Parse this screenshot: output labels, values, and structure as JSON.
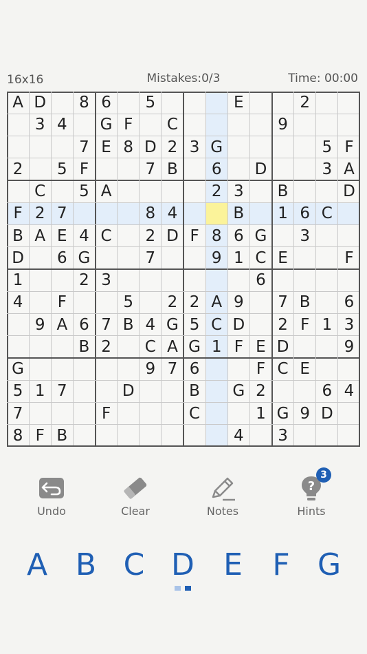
{
  "header": {
    "grid_size": "16x16",
    "mistakes": "Mistakes:0/3",
    "time": "Time: 00:00"
  },
  "board": {
    "size": 16,
    "selected": [
      5,
      9
    ],
    "colors": {
      "highlight": "#e3eefa",
      "selected": "#fbf39a",
      "digit": "#222222"
    },
    "rows": [
      [
        "A",
        "D",
        "",
        "8",
        "6",
        "",
        "5",
        "",
        "",
        "",
        "E",
        "",
        "",
        "2",
        "",
        ""
      ],
      [
        "",
        "3",
        "4",
        "",
        "G",
        "F",
        "",
        "C",
        "",
        "",
        "",
        "",
        "9",
        "",
        "",
        ""
      ],
      [
        "",
        "",
        "",
        "7",
        "E",
        "8",
        "D",
        "2",
        "3",
        "G",
        "",
        "",
        "",
        "",
        "5",
        "F"
      ],
      [
        "2",
        "",
        "5",
        "F",
        "",
        "",
        "7",
        "B",
        "",
        "6",
        "",
        "D",
        "",
        "",
        "3",
        "A"
      ],
      [
        "",
        "C",
        "",
        "5",
        "A",
        "",
        "",
        "",
        "",
        "2",
        "3",
        "",
        "B",
        "",
        "",
        "D"
      ],
      [
        "F",
        "2",
        "7",
        "",
        "",
        "",
        "8",
        "4",
        "",
        "",
        "B",
        "",
        "1",
        "6",
        "C",
        ""
      ],
      [
        "B",
        "A",
        "E",
        "4",
        "C",
        "",
        "2",
        "D",
        "F",
        "8",
        "6",
        "G",
        "",
        "3",
        "",
        ""
      ],
      [
        "D",
        "",
        "6",
        "G",
        "",
        "",
        "7",
        "",
        "",
        "9",
        "1",
        "C",
        "E",
        "",
        "",
        "F"
      ],
      [
        "1",
        "",
        "",
        "2",
        "3",
        "",
        "",
        "",
        "",
        "",
        "",
        "6",
        "",
        "",
        "",
        ""
      ],
      [
        "4",
        "",
        "F",
        "",
        "",
        "5",
        "",
        "2",
        "2",
        "A",
        "9",
        "",
        "7",
        "B",
        "",
        "6"
      ],
      [
        "",
        "9",
        "A",
        "6",
        "7",
        "B",
        "4",
        "G",
        "5",
        "C",
        "D",
        "",
        "2",
        "F",
        "1",
        "3"
      ],
      [
        "",
        "",
        "",
        "B",
        "2",
        "",
        "C",
        "A",
        "G",
        "1",
        "F",
        "E",
        "D",
        "",
        "",
        "9"
      ],
      [
        "G",
        "",
        "",
        "",
        "",
        "",
        "9",
        "7",
        "6",
        "",
        "",
        "F",
        "C",
        "E",
        "",
        ""
      ],
      [
        "5",
        "1",
        "7",
        "",
        "",
        "D",
        "",
        "",
        "B",
        "",
        "G",
        "2",
        "",
        "",
        "6",
        "4"
      ],
      [
        "7",
        "",
        "",
        "",
        "F",
        "",
        "",
        "",
        "C",
        "",
        "",
        "1",
        "G",
        "9",
        "D",
        ""
      ],
      [
        "8",
        "F",
        "B",
        "",
        "",
        "",
        "",
        "",
        "",
        "",
        "4",
        "",
        "3",
        "",
        "",
        ""
      ]
    ]
  },
  "toolbar": {
    "undo_label": "Undo",
    "clear_label": "Clear",
    "notes_label": "Notes",
    "hints_label": "Hints",
    "hints_count": "3",
    "icon_color": "#8a8a8a"
  },
  "digits": [
    "A",
    "B",
    "C",
    "D",
    "E",
    "F",
    "G"
  ],
  "digit_color": "#1f5fb4",
  "page_dots_colors": [
    "#a9c3e8",
    "#1f5fb4"
  ]
}
